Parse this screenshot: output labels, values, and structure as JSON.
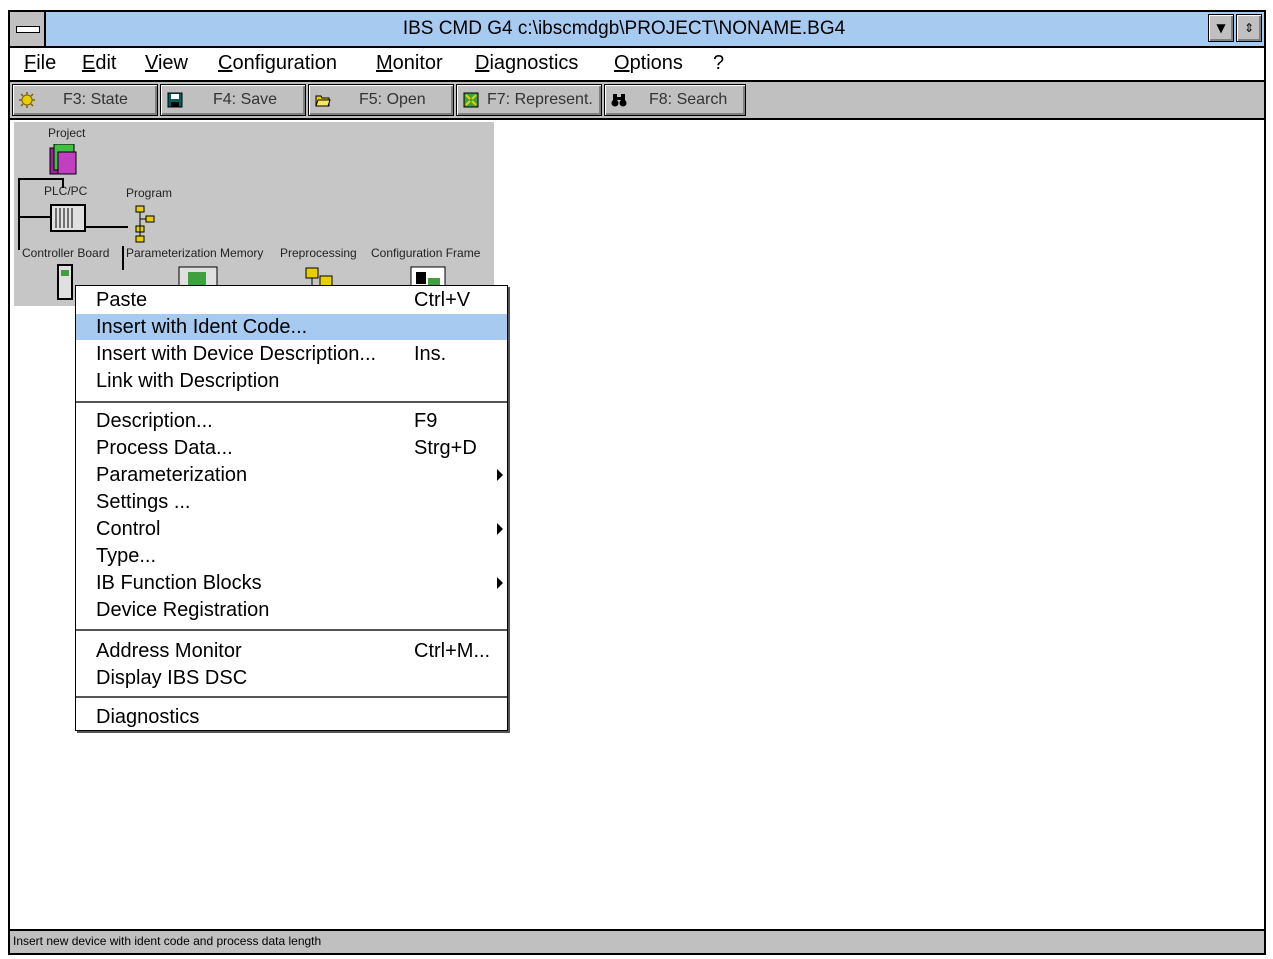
{
  "window": {
    "title": "IBS CMD G4 c:\\ibscmdgb\\PROJECT\\NONAME.BG4",
    "minimize_glyph": "▼",
    "restore_glyph": "⇕"
  },
  "menubar": [
    "File",
    "Edit",
    "View",
    "Configuration",
    "Monitor",
    "Diagnostics",
    "Options",
    "?"
  ],
  "toolbar": [
    {
      "label": "F3: State",
      "icon": "state-icon"
    },
    {
      "label": "F4: Save",
      "icon": "save-disk-icon"
    },
    {
      "label": "F5: Open",
      "icon": "open-folder-icon"
    },
    {
      "label": "F7: Represent.",
      "icon": "represent-icon"
    },
    {
      "label": "F8: Search",
      "icon": "binoculars-icon"
    }
  ],
  "tree": {
    "project": "Project",
    "plc": "PLC/PC",
    "program": "Program",
    "controller": "Controller Board",
    "param_memory": "Parameterization Memory",
    "preprocessing": "Preprocessing",
    "config_frame": "Configuration Frame"
  },
  "context_menu": {
    "groups": [
      [
        {
          "label": "Paste",
          "shortcut": "Ctrl+V"
        },
        {
          "label": "Insert with Ident Code...",
          "shortcut": "",
          "highlighted": true
        },
        {
          "label": "Insert with Device Description...",
          "shortcut": "Ins."
        },
        {
          "label": "Link with Description",
          "shortcut": ""
        }
      ],
      [
        {
          "label": "Description...",
          "shortcut": "F9"
        },
        {
          "label": "Process Data...",
          "shortcut": "Strg+D"
        },
        {
          "label": "Parameterization",
          "shortcut": "",
          "submenu": true
        },
        {
          "label": "Settings ...",
          "shortcut": ""
        },
        {
          "label": "Control",
          "shortcut": "",
          "submenu": true
        },
        {
          "label": "Type...",
          "shortcut": ""
        },
        {
          "label": "IB Function Blocks",
          "shortcut": "",
          "submenu": true
        },
        {
          "label": "Device Registration",
          "shortcut": ""
        }
      ],
      [
        {
          "label": "Address Monitor",
          "shortcut": "Ctrl+M..."
        },
        {
          "label": "Display IBS DSC",
          "shortcut": ""
        }
      ],
      [
        {
          "label": "Diagnostics",
          "shortcut": ""
        }
      ]
    ]
  },
  "statusbar": {
    "text": "Insert new device with ident code and process data length"
  },
  "colors": {
    "titlebar": "#a6caf0",
    "highlight": "#a6caf0",
    "toolbar": "#c0c0c0",
    "tree_bg": "#c6c6c6"
  }
}
